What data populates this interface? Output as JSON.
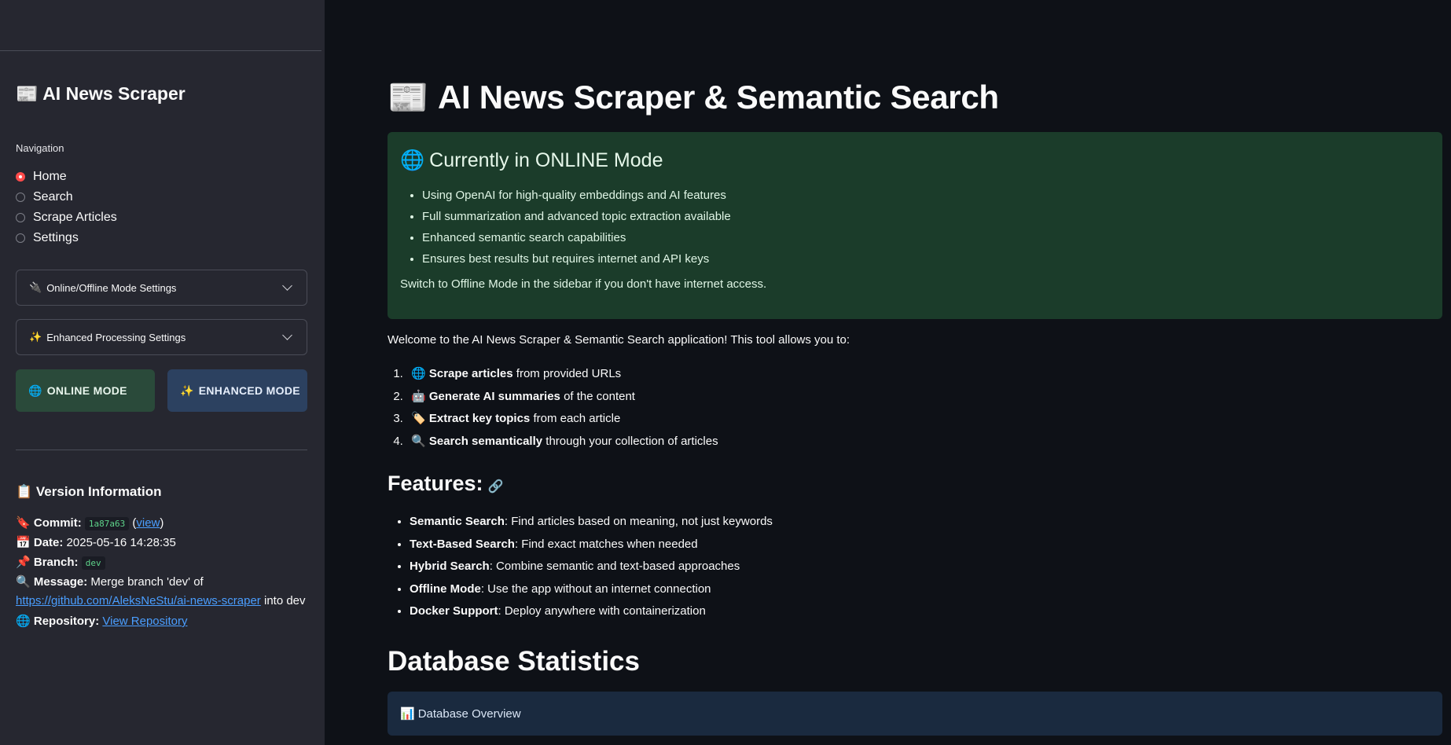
{
  "sidebar": {
    "title_icon": "📰",
    "title": "AI News Scraper",
    "nav_label": "Navigation",
    "nav_items": [
      {
        "label": "Home",
        "selected": true
      },
      {
        "label": "Search",
        "selected": false
      },
      {
        "label": "Scrape Articles",
        "selected": false
      },
      {
        "label": "Settings",
        "selected": false
      }
    ],
    "expanders": [
      {
        "icon": "🔌",
        "label": "Online/Offline Mode Settings"
      },
      {
        "icon": "✨",
        "label": "Enhanced Processing Settings"
      }
    ],
    "mode_buttons": {
      "online": {
        "icon": "🌐",
        "label": "ONLINE MODE"
      },
      "enhanced": {
        "icon": "✨",
        "label": "ENHANCED MODE"
      }
    },
    "version": {
      "title_icon": "📋",
      "title": "Version Information",
      "commit_icon": "🔖",
      "commit_label": "Commit:",
      "commit_hash": "1a87a63",
      "commit_open": "(",
      "commit_link": "view",
      "commit_close": ")",
      "date_icon": "📅",
      "date_label": "Date:",
      "date_value": "2025-05-16 14:28:35",
      "branch_icon": "📌",
      "branch_label": "Branch:",
      "branch_value": "dev",
      "message_icon": "🔍",
      "message_label": "Message:",
      "message_value": "Merge branch 'dev' of",
      "message_link": "https://github.com/AleksNeStu/ai-news-scraper",
      "message_suffix": "into dev",
      "repo_icon": "🌐",
      "repo_label": "Repository:",
      "repo_link": "View Repository"
    }
  },
  "main": {
    "title_icon": "📰",
    "title": "AI News Scraper & Semantic Search",
    "online_box": {
      "icon": "🌐",
      "heading": "Currently in ONLINE Mode",
      "bullets": [
        "Using OpenAI for high-quality embeddings and AI features",
        "Full summarization and advanced topic extraction available",
        "Enhanced semantic search capabilities",
        "Ensures best results but requires internet and API keys"
      ],
      "note": "Switch to Offline Mode in the sidebar if you don't have internet access."
    },
    "welcome": "Welcome to the AI News Scraper & Semantic Search application! This tool allows you to:",
    "steps": [
      {
        "icon": "🌐",
        "bold": "Scrape articles",
        "rest": "from provided URLs"
      },
      {
        "icon": "🤖",
        "bold": "Generate AI summaries",
        "rest": "of the content"
      },
      {
        "icon": "🏷️",
        "bold": "Extract key topics",
        "rest": "from each article"
      },
      {
        "icon": "🔍",
        "bold": "Search semantically",
        "rest": "through your collection of articles"
      }
    ],
    "features_heading": "Features:",
    "features": [
      {
        "bold": "Semantic Search",
        "rest": ": Find articles based on meaning, not just keywords"
      },
      {
        "bold": "Text-Based Search",
        "rest": ": Find exact matches when needed"
      },
      {
        "bold": "Hybrid Search",
        "rest": ": Combine semantic and text-based approaches"
      },
      {
        "bold": "Offline Mode",
        "rest": ": Use the app without an internet connection"
      },
      {
        "bold": "Docker Support",
        "rest": ": Deploy anywhere with containerization"
      }
    ],
    "db_heading": "Database Statistics",
    "db_overview_icon": "📊",
    "db_overview": "Database Overview"
  },
  "colors": {
    "background": "#0e1117",
    "sidebar": "#262730",
    "accent_radio": "#ff4b4b",
    "online_box": "#1b3c2a",
    "info_box": "#1a2a3f",
    "link": "#4a9eff"
  }
}
